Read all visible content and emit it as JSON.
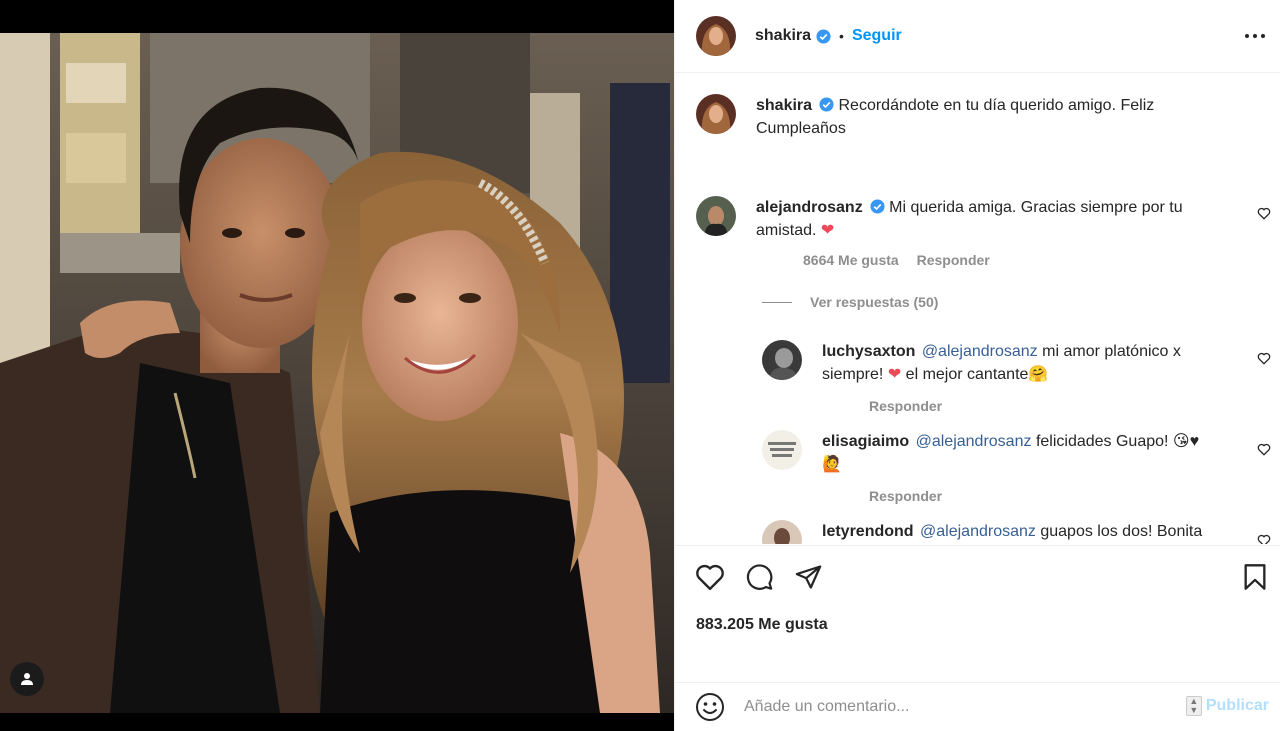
{
  "post": {
    "author": "shakira",
    "follow_label": "Seguir",
    "caption": "Recordándote en tu día querido amigo. Feliz Cumpleaños"
  },
  "comments": [
    {
      "user": "alejandrosanz",
      "verified": true,
      "text": "Mi querida amiga. Gracias siempre por tu amistad.",
      "emoji": "❤",
      "likes": "8664 Me gusta",
      "reply_label": "Responder"
    }
  ],
  "view_replies": "Ver respuestas (50)",
  "replies": [
    {
      "user": "luchysaxton",
      "mention": "@alejandrosanz",
      "text_a": "mi amor platónico x siempre!",
      "heart": "❤",
      "text_b": "el mejor cantante",
      "emoji": "🤗",
      "reply_label": "Responder"
    },
    {
      "user": "elisagiaimo",
      "mention": "@alejandrosanz",
      "text": "felicidades Guapo!",
      "emoji": "😘♥",
      "emoji2": "🙋",
      "reply_label": "Responder"
    },
    {
      "user": "letyrendond",
      "mention": "@alejandrosanz",
      "text": "guapos los dos! Bonita"
    }
  ],
  "likes_total": "883.205 Me gusta",
  "composer": {
    "placeholder": "Añade un comentario...",
    "publish_label": "Publicar"
  },
  "colors": {
    "accent": "#0095f6",
    "verified": "#3897f0",
    "mention": "#375f94",
    "heart": "#ed4956"
  }
}
